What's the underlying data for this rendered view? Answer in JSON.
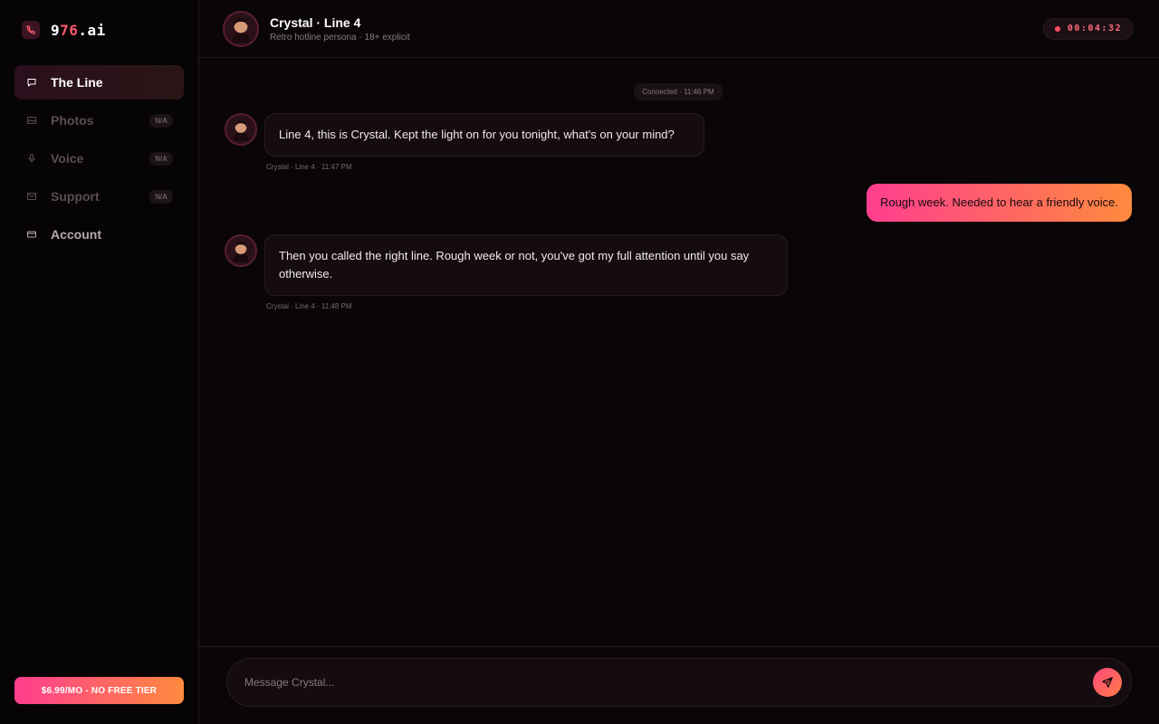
{
  "brand": {
    "part1": "9",
    "part2": "76",
    "part3": ".ai",
    "icon": "phone-icon"
  },
  "nav": {
    "items": [
      {
        "label": "The Line",
        "icon": "chat-icon",
        "active": true
      },
      {
        "label": "Photos",
        "icon": "image-icon",
        "badge": "N/A"
      },
      {
        "label": "Voice",
        "icon": "microphone-icon",
        "badge": "N/A"
      },
      {
        "label": "Support",
        "icon": "mail-icon",
        "badge": "N/A"
      },
      {
        "label": "Account",
        "icon": "card-icon"
      }
    ]
  },
  "cta_label": "$6.99/MO - NO FREE TIER",
  "header": {
    "title": "Crystal · Line 4",
    "subtitle": "Retro hotline persona · 18+ explicit",
    "timer": "00:04:32"
  },
  "chat": {
    "system": "Connected · 11:46 PM",
    "messages": [
      {
        "from": "persona",
        "text": "Line 4, this is Crystal. Kept the light on for you tonight, what's on your mind?",
        "meta": "Crystal · Line 4 · 11:47 PM"
      },
      {
        "from": "user",
        "text": "Rough week. Needed to hear a friendly voice."
      },
      {
        "from": "persona",
        "text": "Then you called the right line. Rough week or not, you've got my full attention until you say otherwise.",
        "meta": "Crystal · Line 4 · 11:48 PM"
      }
    ]
  },
  "composer": {
    "placeholder": "Message Crystal..."
  },
  "colors": {
    "accent_start": "#ff3d8f",
    "accent_end": "#ff8a3d",
    "timer": "#ff6b7e",
    "background": "#0a0608"
  }
}
